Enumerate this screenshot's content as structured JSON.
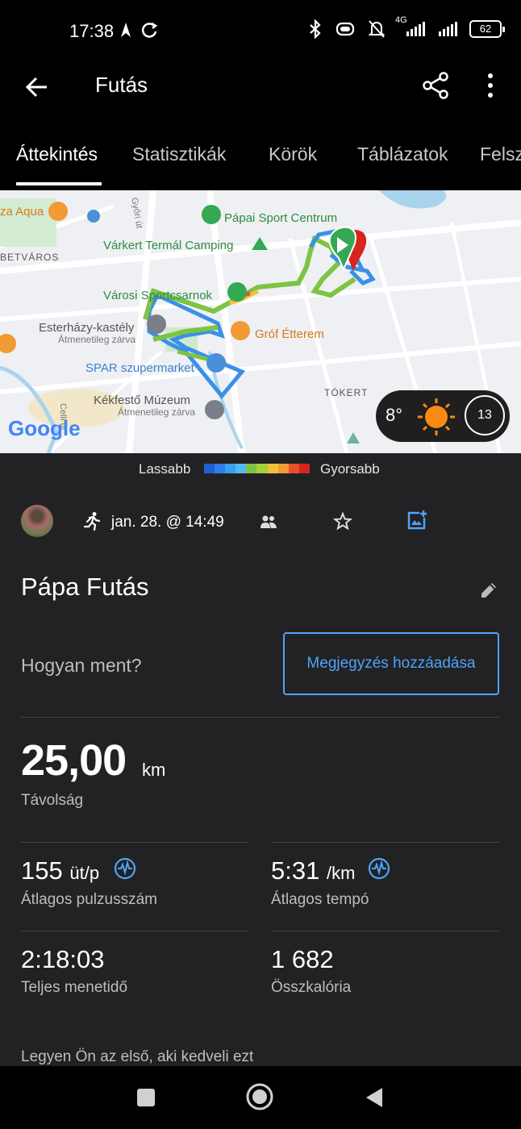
{
  "status_bar": {
    "time": "17:38",
    "network": "4G",
    "battery": "62"
  },
  "app_bar": {
    "title": "Futás",
    "back_icon": "arrow-left-icon",
    "share_icon": "share-icon",
    "menu_icon": "more-vert-icon"
  },
  "tabs": [
    {
      "label": "Áttekintés",
      "active": true
    },
    {
      "label": "Statisztikák",
      "active": false
    },
    {
      "label": "Körök",
      "active": false
    },
    {
      "label": "Táblázatok",
      "active": false
    },
    {
      "label": "Felsz",
      "active": false
    }
  ],
  "map": {
    "labels": {
      "aqua": "za Aqua",
      "sport_centrum": "Pápai Sport Centrum",
      "varkert": "Várkert Termál Camping",
      "betvaros": "BETVÁROS",
      "varosi": "Városi Sportcsarnok",
      "esterhazy": "Esterházy-kastély",
      "esterhazy_sub": "Átmenetileg zárva",
      "grof": "Gróf Étterem",
      "spar": "SPAR szupermarket",
      "kekfesto": "Kékfestő Múzeum",
      "kekfesto_sub": "Átmenetileg zárva",
      "tokert": "TÓKERT",
      "gyori": "Győri út",
      "celli": "Celli út",
      "google": "Google"
    },
    "weather": {
      "temperature": "8°",
      "wind": "13"
    }
  },
  "legend": {
    "slower": "Lassabb",
    "faster": "Gyorsabb",
    "colors": [
      "#1f5fd6",
      "#2f7fe8",
      "#3aa0f0",
      "#56b8f2",
      "#7cc442",
      "#a6cf3c",
      "#f2c13c",
      "#f29a34",
      "#e8502c",
      "#d8231f"
    ]
  },
  "activity": {
    "date": "jan. 28. @ 14:49",
    "name": "Pápa Futás",
    "how_prompt": "Hogyan ment?",
    "note_button": "Megjegyzés hozzáadása",
    "distance": {
      "value": "25,00",
      "unit": "km",
      "label": "Távolság"
    },
    "stats": [
      {
        "value": "155",
        "unit": "üt/p",
        "label": "Átlagos pulzusszám"
      },
      {
        "value": "5:31",
        "unit": "/km",
        "label": "Átlagos tempó"
      },
      {
        "value": "2:18:03",
        "unit": "",
        "label": "Teljes menetidő"
      },
      {
        "value": "1 682",
        "unit": "",
        "label": "Összkalória"
      }
    ],
    "likes_text": "Legyen Ön az első, aki kedveli ezt"
  },
  "colors": {
    "accent": "#4fa3f7",
    "background": "#222224",
    "route_green": "#7cc442",
    "route_blue": "#3a8fe8"
  }
}
